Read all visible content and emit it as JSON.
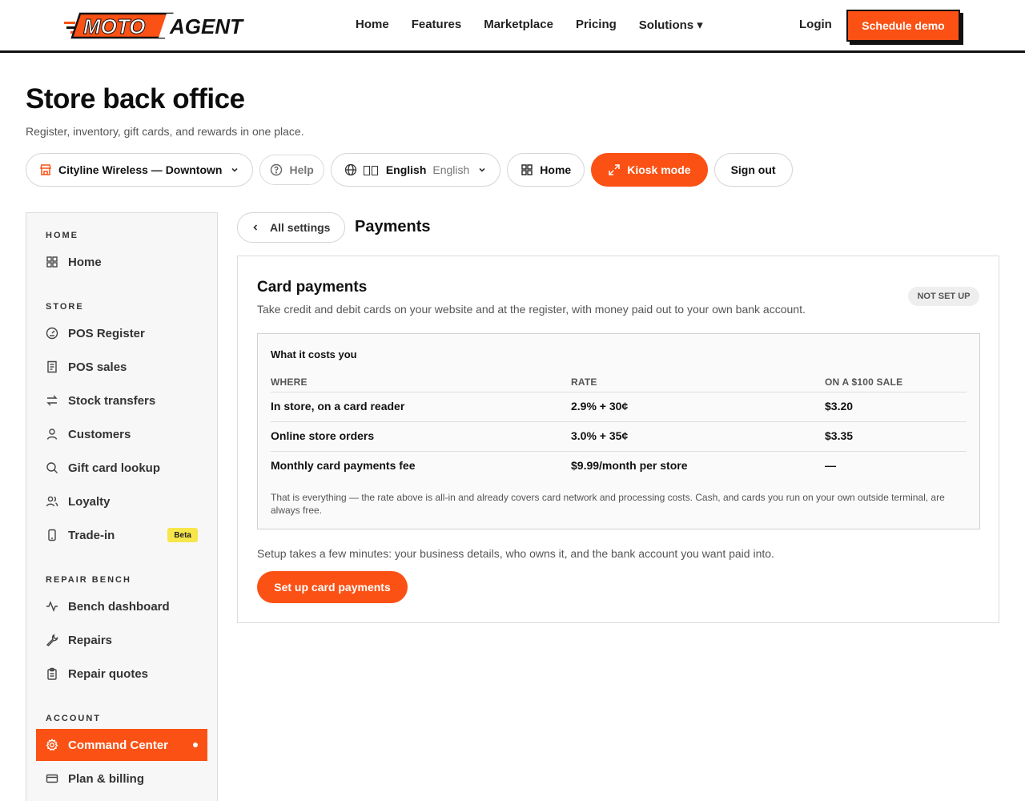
{
  "brand": {
    "logo_part1": "MOTO",
    "logo_part2": "AGENT",
    "accent": "#fb5114"
  },
  "nav": {
    "links": [
      "Home",
      "Features",
      "Marketplace",
      "Pricing",
      "Solutions ▾"
    ],
    "login": "Login",
    "cta": "Schedule demo"
  },
  "header": {
    "title": "Store back office",
    "subtitle": "Register, inventory, gift cards, and rewards in one place."
  },
  "toolbar": {
    "store": "Cityline Wireless — Downtown",
    "help": "Help",
    "language": "English",
    "language_native": "English",
    "home": "Home",
    "kiosk": "Kiosk mode",
    "signout": "Sign out"
  },
  "sidebar": {
    "sections": [
      {
        "label": "HOME",
        "items": [
          {
            "label": "Home",
            "icon": "grid-icon"
          }
        ]
      },
      {
        "label": "STORE",
        "items": [
          {
            "label": "POS Register",
            "icon": "gauge-icon"
          },
          {
            "label": "POS sales",
            "icon": "receipt-icon"
          },
          {
            "label": "Stock transfers",
            "icon": "arrows-icon"
          },
          {
            "label": "Customers",
            "icon": "user-icon"
          },
          {
            "label": "Gift card lookup",
            "icon": "search-icon"
          },
          {
            "label": "Loyalty",
            "icon": "users-icon"
          },
          {
            "label": "Trade-in",
            "icon": "phone-icon",
            "badge": "Beta"
          }
        ]
      },
      {
        "label": "REPAIR BENCH",
        "items": [
          {
            "label": "Bench dashboard",
            "icon": "pulse-icon"
          },
          {
            "label": "Repairs",
            "icon": "wrench-icon"
          },
          {
            "label": "Repair quotes",
            "icon": "clipboard-icon"
          }
        ]
      },
      {
        "label": "ACCOUNT",
        "items": [
          {
            "label": "Command Center",
            "icon": "gear-icon",
            "active": true
          },
          {
            "label": "Plan & billing",
            "icon": "card-icon"
          }
        ]
      }
    ]
  },
  "main": {
    "back_label": "All settings",
    "section_title": "Payments",
    "card": {
      "title": "Card payments",
      "description": "Take credit and debit cards on your website and at the register, with money paid out to your own bank account.",
      "status": "NOT SET UP",
      "costs": {
        "title": "What it costs you",
        "headers": [
          "WHERE",
          "RATE",
          "ON A $100 SALE"
        ],
        "rows": [
          [
            "In store, on a card reader",
            "2.9% + 30¢",
            "$3.20"
          ],
          [
            "Online store orders",
            "3.0% + 35¢",
            "$3.35"
          ],
          [
            "Monthly card payments fee",
            "$9.99/month per store",
            "—"
          ]
        ],
        "note": "That is everything — the rate above is all-in and already covers card network and processing costs. Cash, and cards you run on your own outside terminal, are always free."
      },
      "setup_text": "Setup takes a few minutes: your business details, who owns it, and the bank account you want paid into.",
      "setup_button": "Set up card payments"
    }
  }
}
